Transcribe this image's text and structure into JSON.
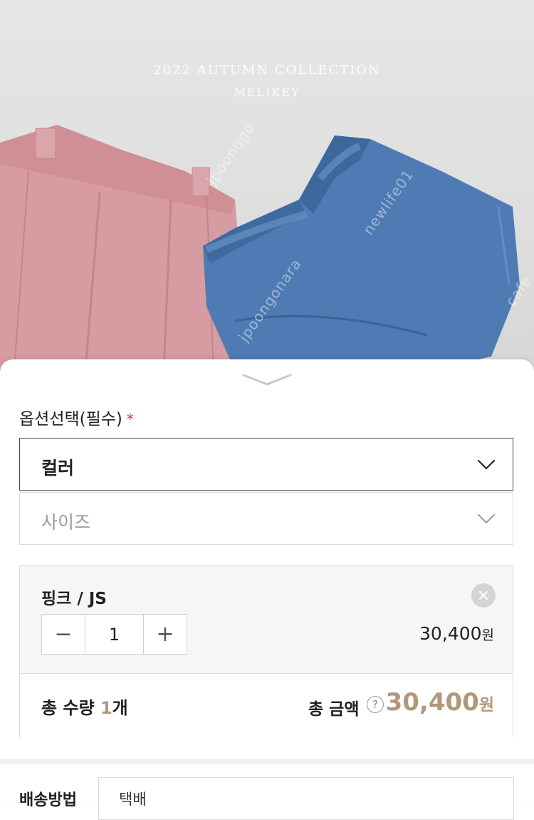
{
  "hero": {
    "caption_line1": "2022 AUTUMN COLLECTION",
    "caption_line2": "MELIKEY",
    "watermark_1": "jpoonggo",
    "watermark_2": "newlife01",
    "watermark_3": "jpoongonara",
    "watermark_4": "cafe"
  },
  "sheet": {
    "handle_icon": "chevron-down-icon",
    "option_title": "옵션선택(필수)",
    "required_mark": "*",
    "selects": {
      "color_label": "컬러",
      "size_label": "사이즈"
    },
    "selected_item": {
      "name": "핑크 / JS",
      "quantity": "1",
      "minus": "−",
      "plus": "+",
      "price_value": "30,400",
      "price_unit": "원"
    },
    "total": {
      "qty_prefix": "총 수량 ",
      "qty_value": "1",
      "qty_suffix": "개",
      "amount_label": "총 금액",
      "help": "?",
      "amount_value": "30,400",
      "amount_unit": "원"
    },
    "shipping": {
      "label": "배송방법",
      "value": "택배"
    }
  },
  "colors": {
    "accent": "#b3977a",
    "required": "#d13b3b"
  }
}
